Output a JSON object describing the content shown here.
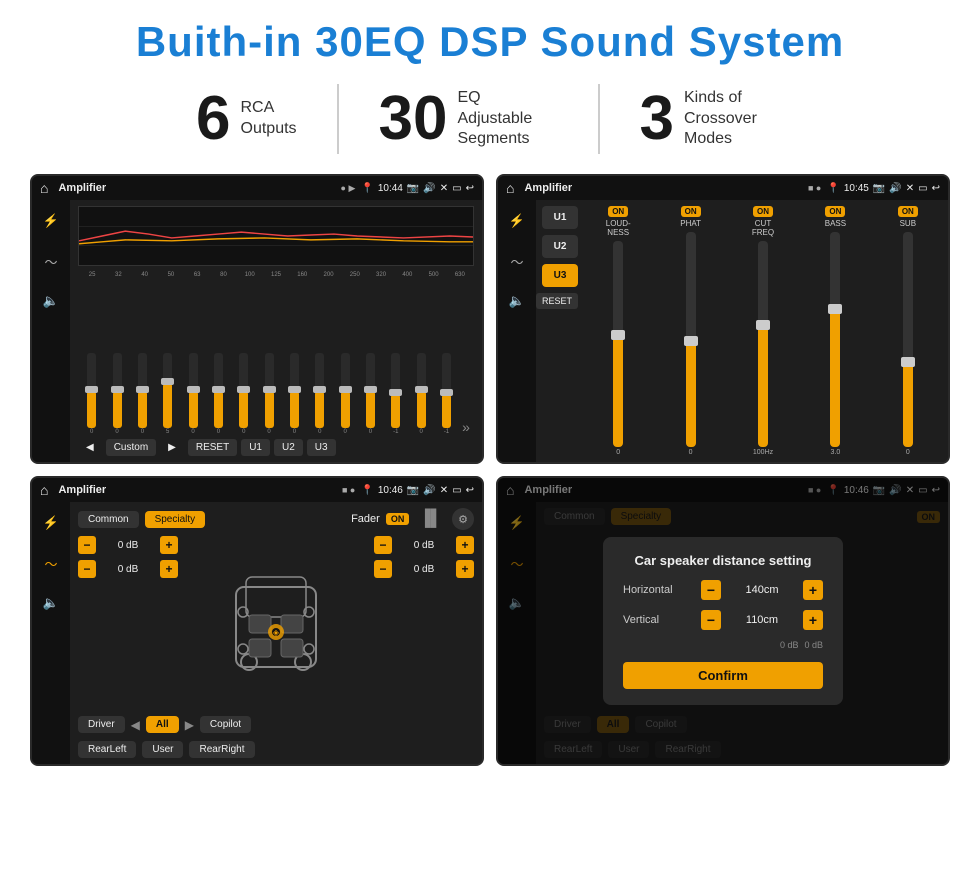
{
  "page": {
    "title": "Buith-in 30EQ DSP Sound System",
    "stats": [
      {
        "number": "6",
        "label": "RCA\nOutputs"
      },
      {
        "number": "30",
        "label": "EQ Adjustable\nSegments"
      },
      {
        "number": "3",
        "label": "Kinds of\nCrossover Modes"
      }
    ],
    "screens": [
      {
        "id": "eq-screen",
        "statusbar": {
          "title": "Amplifier",
          "time": "10:44"
        },
        "type": "eq"
      },
      {
        "id": "crossover-screen",
        "statusbar": {
          "title": "Amplifier",
          "time": "10:45"
        },
        "type": "crossover"
      },
      {
        "id": "fader-screen",
        "statusbar": {
          "title": "Amplifier",
          "time": "10:46"
        },
        "type": "fader"
      },
      {
        "id": "dialog-screen",
        "statusbar": {
          "title": "Amplifier",
          "time": "10:46"
        },
        "type": "fader-dialog"
      }
    ],
    "eq": {
      "freqs": [
        "25",
        "32",
        "40",
        "50",
        "63",
        "80",
        "100",
        "125",
        "160",
        "200",
        "250",
        "320",
        "400",
        "500",
        "630"
      ],
      "values": [
        "0",
        "0",
        "0",
        "5",
        "0",
        "0",
        "0",
        "0",
        "0",
        "0",
        "0",
        "0",
        "-1",
        "0",
        "-1"
      ],
      "sliderPositions": [
        50,
        50,
        50,
        60,
        50,
        50,
        50,
        50,
        50,
        50,
        50,
        50,
        45,
        50,
        45
      ],
      "bottomLabels": [
        "Custom",
        "RESET",
        "U1",
        "U2",
        "U3"
      ]
    },
    "crossover": {
      "presets": [
        "U1",
        "U2",
        "U3"
      ],
      "activePreset": "U3",
      "groups": [
        {
          "label": "LOUDNESS",
          "on": true,
          "fillPct": 55
        },
        {
          "label": "PHAT",
          "on": true,
          "fillPct": 50
        },
        {
          "label": "CUT FREQ",
          "on": true,
          "fillPct": 60
        },
        {
          "label": "BASS",
          "on": true,
          "fillPct": 65
        },
        {
          "label": "SUB",
          "on": true,
          "fillPct": 40
        }
      ]
    },
    "fader": {
      "tabs": [
        "Common",
        "Specialty"
      ],
      "activeTab": "Specialty",
      "faderLabel": "Fader",
      "faderOn": "ON",
      "leftControls": [
        {
          "value": "0 dB"
        },
        {
          "value": "0 dB"
        }
      ],
      "rightControls": [
        {
          "value": "0 dB"
        },
        {
          "value": "0 dB"
        }
      ],
      "bottomBtns": [
        "Driver",
        "All",
        "RearLeft",
        "User",
        "RearRight",
        "Copilot"
      ]
    },
    "dialog": {
      "title": "Car speaker distance setting",
      "rows": [
        {
          "label": "Horizontal",
          "value": "140cm"
        },
        {
          "label": "Vertical",
          "value": "110cm"
        }
      ],
      "confirmLabel": "Confirm"
    }
  }
}
